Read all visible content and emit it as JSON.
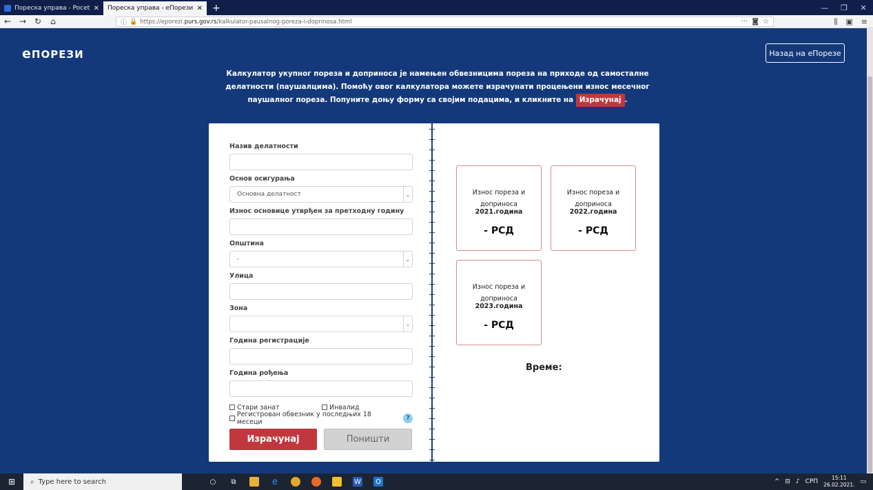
{
  "browser": {
    "tabs": [
      {
        "title": "Пореска управа - Pocetna",
        "active": false
      },
      {
        "title": "Пореска управа - еПорези :: Калк",
        "active": true
      }
    ],
    "new_tab": "+",
    "url_host_prefix": "https://eporezi.",
    "url_host_bold": "purs.gov.rs",
    "url_path": "/kalkulator-pausalnog-poreza-i-doprinosa.html",
    "url_more": "···"
  },
  "header": {
    "logo_e": "е",
    "logo_rest": "ПОРЕЗИ",
    "back_button": "Назад на еПорезе"
  },
  "intro": {
    "text_before": "Калкулатор укупног пореза и доприноса је намењен обвезницима пореза на приходе од самосталне делатности (паушалцима). Помоћу овог калкулатора можете израчунати процењени износ месечног паушалног пореза. Попуните доњу форму са својим подацима, и кликните на",
    "badge": "Израчунај",
    "text_after": "."
  },
  "form": {
    "activity_label": "Назив делатности",
    "activity_value": "",
    "insurance_label": "Основ осигурања",
    "insurance_value": "Основна делатност",
    "base_label": "Износ основице утврђен за претходну годину",
    "base_value": "",
    "municipality_label": "Општина",
    "municipality_value": "-",
    "street_label": "Улица",
    "street_value": "",
    "zone_label": "Зона",
    "zone_value": "",
    "reg_year_label": "Година регистрације",
    "reg_year_value": "",
    "birth_year_label": "Година рођења",
    "birth_year_value": "",
    "old_craft_label": "Стари занат",
    "disabled_label": "Инвалид",
    "registered_label": "Регистрован обвезник у последњих 18 месеци",
    "help": "?",
    "calc_button": "Израчунај",
    "cancel_button": "Поништи"
  },
  "results": [
    {
      "line1": "Износ пореза и",
      "line2_pre": "доприноса ",
      "year": "2021.година",
      "value": "- РСД"
    },
    {
      "line1": "Износ пореза и",
      "line2_pre": "доприноса ",
      "year": "2022.година",
      "value": "- РСД"
    },
    {
      "line1": "Износ пореза и",
      "line2_pre": "доприноса ",
      "year": "2023.година",
      "value": "- РСД"
    }
  ],
  "time_label": "Време:",
  "taskbar": {
    "search_placeholder": "Type here to search",
    "lang": "СРП",
    "time": "15:11",
    "date": "26.02.2021."
  },
  "colors": {
    "page_bg": "#14397a",
    "accent_red": "#c0383e"
  }
}
